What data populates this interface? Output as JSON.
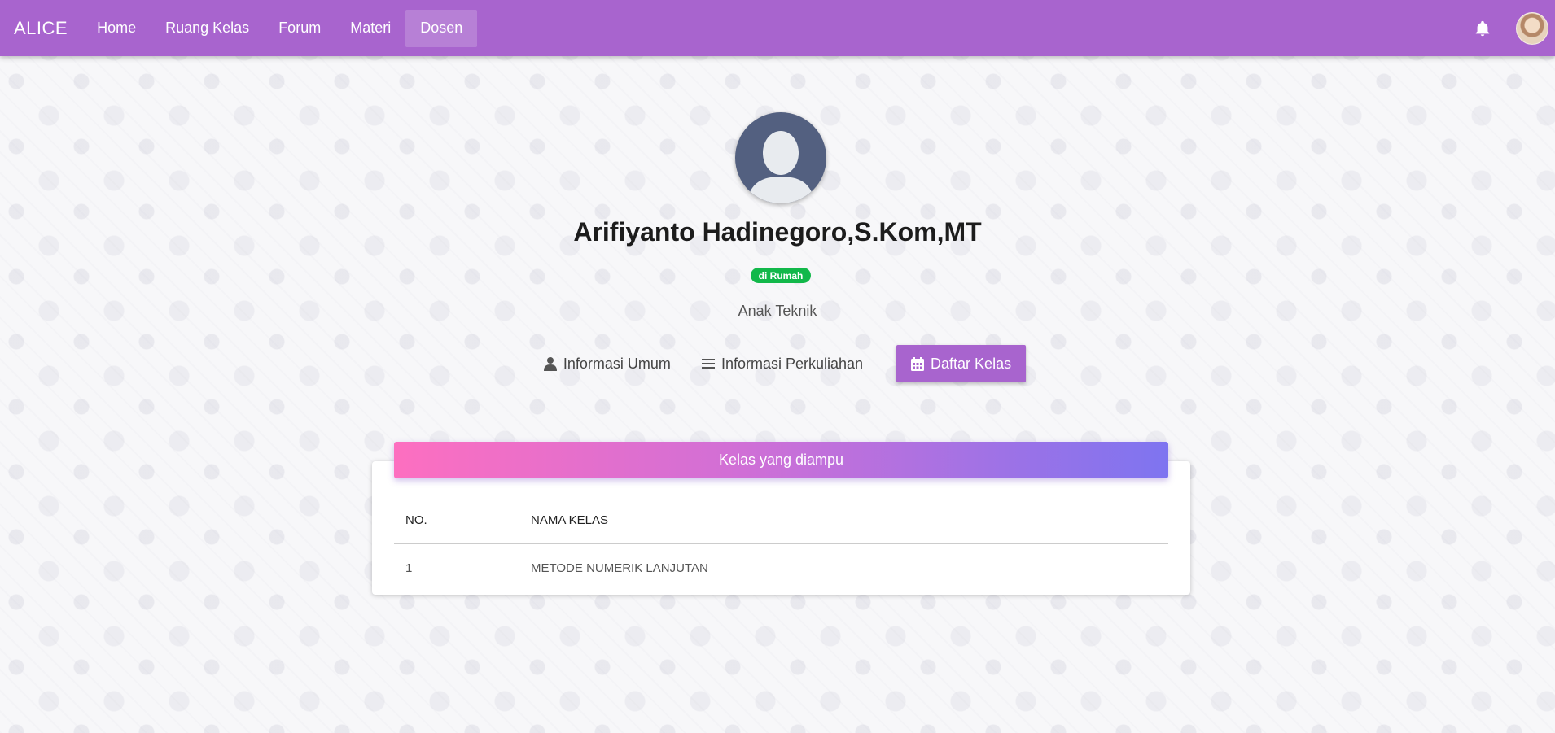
{
  "nav": {
    "brand": "ALICE",
    "items": [
      {
        "label": "Home",
        "active": false
      },
      {
        "label": "Ruang Kelas",
        "active": false
      },
      {
        "label": "Forum",
        "active": false
      },
      {
        "label": "Materi",
        "active": false
      },
      {
        "label": "Dosen",
        "active": true
      }
    ],
    "bell_icon": "bell-icon",
    "accent_color": "#a864ce"
  },
  "profile": {
    "name": "Arifiyanto Hadinegoro,S.Kom,MT",
    "status": "di Rumah",
    "status_color": "#12b84a",
    "subtitle": "Anak Teknik"
  },
  "tabs": [
    {
      "label": "Informasi Umum",
      "icon": "user-icon",
      "active": false
    },
    {
      "label": "Informasi Perkuliahan",
      "icon": "list-icon",
      "active": false
    },
    {
      "label": "Daftar Kelas",
      "icon": "calendar-icon",
      "active": true
    }
  ],
  "classes_card": {
    "title": "Kelas yang diampu",
    "columns": [
      "NO.",
      "NAMA KELAS"
    ],
    "rows": [
      [
        "1",
        "METODE NUMERIK LANJUTAN"
      ]
    ]
  }
}
